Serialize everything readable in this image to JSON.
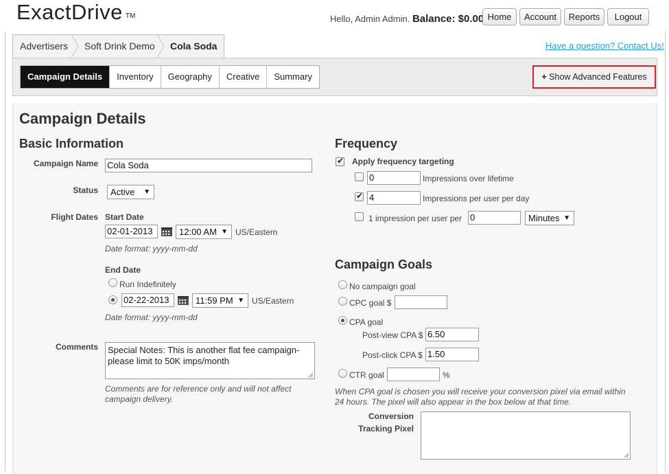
{
  "header": {
    "logo": "ExactDrive",
    "tm": "TM",
    "greeting": "Hello, Admin Admin.",
    "balance": "Balance: $0.00",
    "buttons": {
      "home": "Home",
      "account": "Account",
      "reports": "Reports",
      "logout": "Logout"
    }
  },
  "breadcrumb": {
    "items": [
      "Advertisers",
      "Soft Drink Demo",
      "Cola Soda"
    ]
  },
  "contact_link": "Have a question? Contact Us!",
  "tabs": [
    "Campaign Details",
    "Inventory",
    "Geography",
    "Creative",
    "Summary"
  ],
  "advanced_button": "Show Advanced Features",
  "page_title": "Campaign Details",
  "basic": {
    "title": "Basic Information",
    "campaign_name_label": "Campaign Name",
    "campaign_name_value": "Cola Soda",
    "status_label": "Status",
    "status_value": "Active",
    "flight_label": "Flight Dates",
    "start_label": "Start Date",
    "start_date": "02-01-2013",
    "start_time": "12:00 AM",
    "timezone": "US/Eastern",
    "date_format": "Date format: yyyy-mm-dd",
    "end_label": "End Date",
    "run_indefinitely": "Run Indefinitely",
    "end_date": "02-22-2013",
    "end_time": "11:59 PM",
    "comments_label": "Comments",
    "comments_value": "Special Notes: This is another flat fee campaign- please limit to 50K imps/month",
    "comments_hint": "Comments are for reference only and will not affect campaign delivery."
  },
  "frequency": {
    "title": "Frequency",
    "apply_label": "Apply frequency targeting",
    "lifetime_value": "0",
    "lifetime_label": "Impressions over lifetime",
    "per_day_value": "4",
    "per_day_label": "Impressions per user per day",
    "one_impression_label": "1 impression per user per",
    "one_impression_value": "0",
    "unit_value": "Minutes"
  },
  "goals": {
    "title": "Campaign Goals",
    "no_goal": "No campaign goal",
    "cpc_label": "CPC goal $",
    "cpc_value": "",
    "cpa_label": "CPA goal",
    "post_view_label": "Post-view CPA $",
    "post_view_value": "6.50",
    "post_click_label": "Post-click CPA $",
    "post_click_value": "1.50",
    "ctr_label": "CTR goal",
    "ctr_value": "",
    "ctr_unit": "%",
    "cpa_hint": "When CPA goal is chosen you will receive your conversion pixel via email within 24 hours. The pixel will also appear in the box below at that time.",
    "pixel_label_1": "Conversion",
    "pixel_label_2": "Tracking Pixel",
    "pixel_value": ""
  },
  "colors": {
    "accent_link": "#2a9fd6",
    "active_tab": "#111111",
    "highlight_border": "#d8202a"
  }
}
